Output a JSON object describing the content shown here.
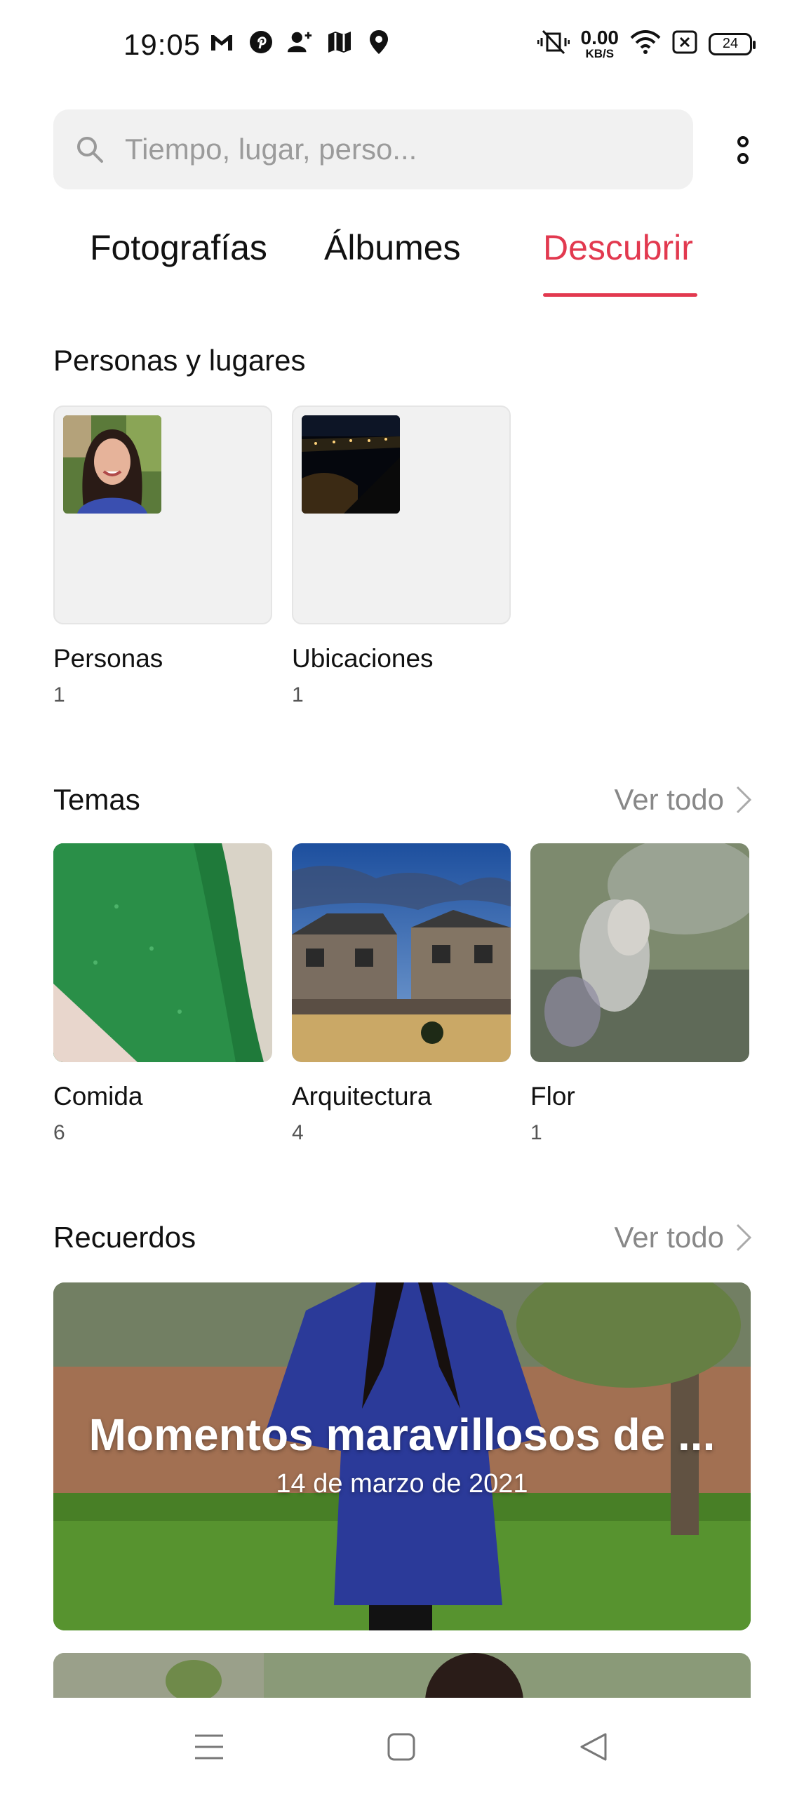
{
  "status_bar": {
    "time": "19:05",
    "left_icons": [
      "gmail-icon",
      "pinterest-icon",
      "add-contact-icon",
      "maps-icon",
      "location-icon"
    ],
    "right_icons": [
      "vibrate-icon",
      "wifi-icon",
      "sim-icon",
      "battery-icon"
    ],
    "net_speed_value": "0.00",
    "net_speed_unit": "KB/S",
    "battery_level": "24"
  },
  "search": {
    "placeholder": "Tiempo, lugar, perso..."
  },
  "tabs": [
    {
      "label": "Fotografías",
      "active": false
    },
    {
      "label": "Álbumes",
      "active": false
    },
    {
      "label": "Descubrir",
      "active": true
    }
  ],
  "people_places": {
    "title": "Personas y lugares",
    "items": [
      {
        "label": "Personas",
        "count": "1"
      },
      {
        "label": "Ubicaciones",
        "count": "1"
      }
    ]
  },
  "themes": {
    "title": "Temas",
    "see_all": "Ver todo",
    "items": [
      {
        "label": "Comida",
        "count": "6"
      },
      {
        "label": "Arquitectura",
        "count": "4"
      },
      {
        "label": "Flor",
        "count": "1"
      }
    ]
  },
  "memories": {
    "title": "Recuerdos",
    "see_all": "Ver todo",
    "items": [
      {
        "title": "Momentos maravillosos de ...",
        "date": "14 de marzo de 2021"
      }
    ]
  },
  "colors": {
    "accent": "#e2394f",
    "search_bg": "#f1f1f1",
    "secondary_text": "#888888"
  },
  "nav_bar": {
    "icons": [
      "menu-icon",
      "home-icon",
      "back-icon"
    ]
  }
}
